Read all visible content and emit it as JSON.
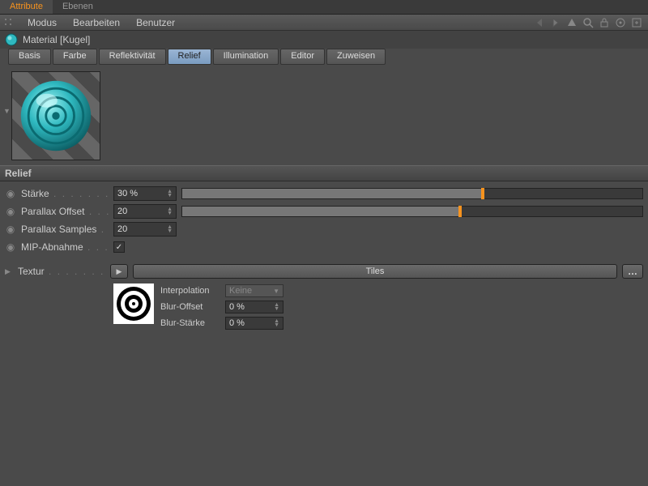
{
  "top_tabs": {
    "attribute": "Attribute",
    "ebenen": "Ebenen"
  },
  "menubar": {
    "modus": "Modus",
    "bearbeiten": "Bearbeiten",
    "benutzer": "Benutzer"
  },
  "material": {
    "name": "Material [Kugel]"
  },
  "sub_tabs": {
    "basis": "Basis",
    "farbe": "Farbe",
    "reflekt": "Reflektivität",
    "relief": "Relief",
    "illumination": "Illumination",
    "editor": "Editor",
    "zuweisen": "Zuweisen"
  },
  "section_title": "Relief",
  "params": {
    "staerke": {
      "label": "Stärke",
      "value": "30 %",
      "pct": 65
    },
    "parallax_offset": {
      "label": "Parallax Offset",
      "value": "20",
      "pct": 60
    },
    "parallax_samples": {
      "label": "Parallax Samples",
      "value": "20"
    },
    "mip": {
      "label": "MIP-Abnahme",
      "checked": true
    }
  },
  "textur": {
    "label": "Textur",
    "value": "Tiles",
    "interpolation": {
      "label": "Interpolation",
      "value": "Keine"
    },
    "blur_offset": {
      "label": "Blur-Offset",
      "value": "0 %"
    },
    "blur_staerke": {
      "label": "Blur-Stärke",
      "value": "0 %"
    }
  },
  "colors": {
    "accent": "#f7931e",
    "teal": "#2fb9c0"
  }
}
